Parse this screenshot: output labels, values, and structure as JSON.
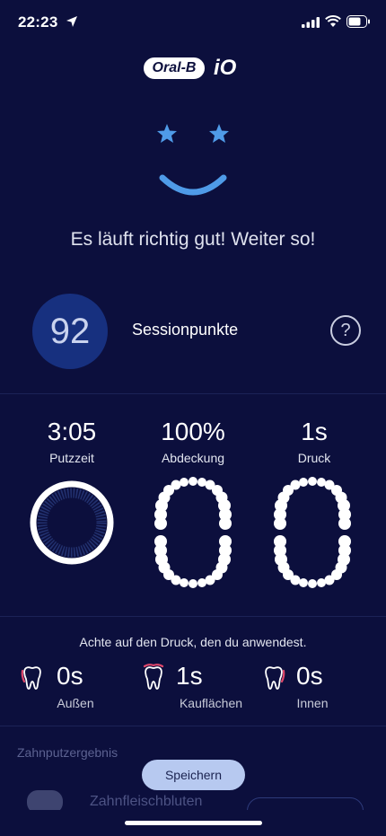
{
  "status_bar": {
    "time": "22:23"
  },
  "brand": {
    "name": "Oral-B",
    "product": "iO"
  },
  "feedback": {
    "message": "Es läuft richtig gut! Weiter so!"
  },
  "session": {
    "score": "92",
    "label": "Sessionpunkte",
    "help_symbol": "?"
  },
  "stats": [
    {
      "value": "3:05",
      "label": "Putzzeit"
    },
    {
      "value": "100%",
      "label": "Abdeckung"
    },
    {
      "value": "1s",
      "label": "Druck"
    }
  ],
  "pressure": {
    "advice": "Achte auf den Druck, den du anwendest.",
    "zones": [
      {
        "value": "0s",
        "label": "Außen",
        "icon": "tooth-outer-icon"
      },
      {
        "value": "1s",
        "label": "Kauflächen",
        "icon": "tooth-chewing-icon"
      },
      {
        "value": "0s",
        "label": "Innen",
        "icon": "tooth-inner-icon"
      }
    ]
  },
  "result": {
    "section_title": "Zahnputzergebnis",
    "faded_item": "Zahnfleischbluten"
  },
  "actions": {
    "save_label": "Speichern"
  },
  "colors": {
    "background": "#0c0f3d",
    "accent": "#4f9be8",
    "score_circle": "#17307f",
    "pressure_marker": "#e0476b",
    "button": "#b7c9f0"
  }
}
